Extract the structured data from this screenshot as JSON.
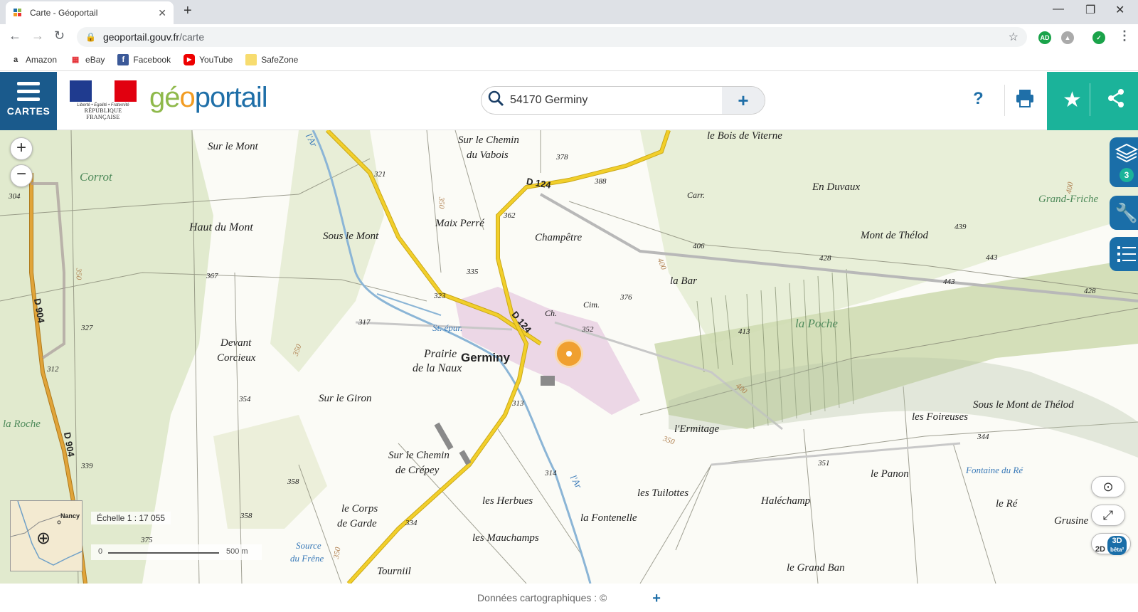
{
  "browser": {
    "tab_title": "Carte - Géoportail",
    "url_host": "geoportail.gouv.fr",
    "url_path": "/carte",
    "bookmarks": [
      "Amazon",
      "eBay",
      "Facebook",
      "YouTube",
      "SafeZone"
    ]
  },
  "header": {
    "menu_label": "CARTES",
    "rf_motto": "Liberté • Égalité • Fraternité",
    "rf_name": "RÉPUBLIQUE FRANÇAISE",
    "logo_part1": "gé",
    "logo_part2": "o",
    "logo_part3": "portail",
    "search_value": "54170 Germiny",
    "help_label": "?"
  },
  "map": {
    "labels": {
      "sur_le_chemin_vabois_1": "Sur le Chemin",
      "sur_le_chemin_vabois_2": "du Vabois",
      "bois_de_viterne": "le Bois de Viterne",
      "sur_le_mont": "Sur le Mont",
      "corrot": "Corrot",
      "en_duvaux": "En Duvaux",
      "grand_friche": "Grand-Friche",
      "haut_du_mont": "Haut du Mont",
      "sous_le_mont": "Sous le Mont",
      "maix_perre": "Maix Perré",
      "champetre": "Champêtre",
      "mont_de_thelod": "Mont de Thélod",
      "la_bar": "la Bar",
      "la_poche": "la Poche",
      "st_epur": "St. épur.",
      "prairie_naux_1": "Prairie",
      "prairie_naux_2": "de la Naux",
      "germiny": "Germiny",
      "devant_corcieux_1": "Devant",
      "devant_corcieux_2": "Corcieux",
      "sur_le_giron": "Sur le Giron",
      "la_roche": "la Roche",
      "lermitage": "l'Ermitage",
      "les_foireuses": "les Foireuses",
      "sous_le_mont_thelod": "Sous le Mont de Thélod",
      "sur_chemin_crepey_1": "Sur le Chemin",
      "sur_chemin_crepey_2": "de Crépey",
      "fontaine_du_re": "Fontaine du Ré",
      "le_panon": "le Panon",
      "les_tuilottes": "les Tuilottes",
      "halechamp": "Haléchamp",
      "le_re": "le Ré",
      "grusine": "Grusine",
      "les_herbues": "les Herbues",
      "le_corps_de_garde_1": "le Corps",
      "le_corps_de_garde_2": "de Garde",
      "la_fontenelle": "la Fontenelle",
      "les_mauchamps": "les Mauchamps",
      "source_du_frene_1": "Source",
      "source_du_frene_2": "du Frêne",
      "le_grand_ban": "le Grand Ban",
      "tourniil": "Tourniil",
      "lar_1": "l'Ar",
      "lar_2": "l'Ar",
      "carr": "Carr.",
      "cim": "Cim.",
      "ch": "Ch."
    },
    "roads": {
      "d124_a": "D 124",
      "d124_b": "D 124",
      "d904_a": "D 904",
      "d904_b": "D 904"
    },
    "elevations": [
      "378",
      "388",
      "321",
      "362",
      "304",
      "367",
      "335",
      "323",
      "406",
      "428",
      "439",
      "443",
      "443",
      "428",
      "376",
      "352",
      "317",
      "327",
      "413",
      "312",
      "354",
      "313",
      "344",
      "351",
      "339",
      "358",
      "314",
      "358",
      "334",
      "375",
      "350",
      "350",
      "400",
      "400",
      "350",
      "400",
      "350",
      "350"
    ],
    "minimap_label": "Nancy",
    "scale_text": "Échelle 1 : 17 055",
    "scale_start": "0",
    "scale_end": "500 m",
    "layers_count": "3",
    "view_2d": "2D",
    "view_3d": "3D",
    "view_3d_sub": "bêta²"
  },
  "footer": {
    "attribution": "Données cartographiques : ©",
    "expand": "+"
  },
  "colors": {
    "header_blue": "#1a5a8c",
    "teal": "#1bb39a",
    "road_yellow": "#f2cf2a",
    "marker_orange": "#f0a030"
  }
}
